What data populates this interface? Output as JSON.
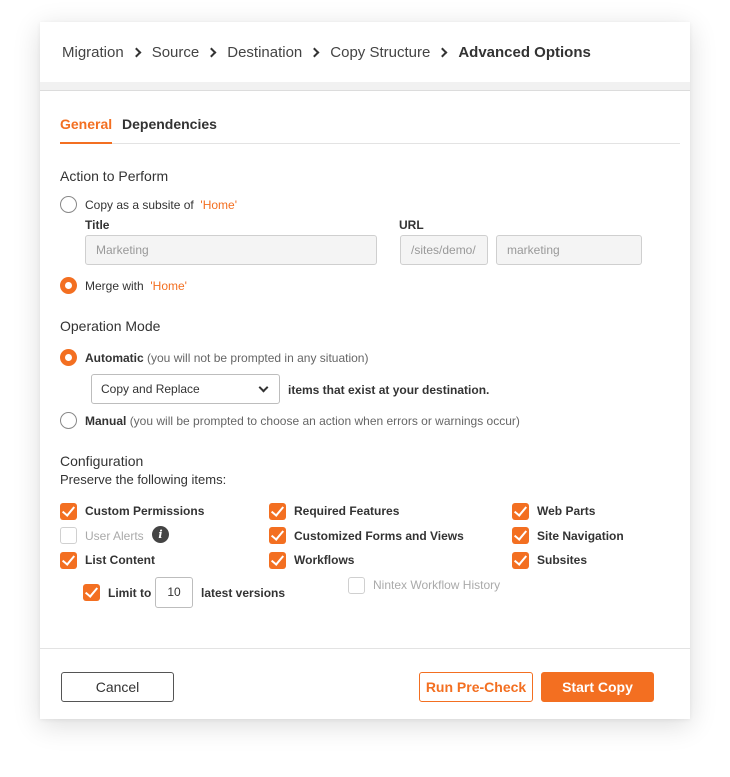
{
  "breadcrumb": {
    "items": [
      "Migration",
      "Source",
      "Destination",
      "Copy Structure",
      "Advanced Options"
    ]
  },
  "tabs": [
    {
      "label": "General",
      "active": true
    },
    {
      "label": "Dependencies",
      "active": false
    }
  ],
  "action": {
    "title": "Action to Perform",
    "subsite_prefix": "Copy as a subsite of",
    "subsite_target": "'Home'",
    "title_label": "Title",
    "url_label": "URL",
    "title_placeholder": "Marketing",
    "url_prefix": "/sites/demo/",
    "url_placeholder": "marketing",
    "merge_prefix": "Merge with",
    "merge_target": "'Home'",
    "selected": "merge"
  },
  "operation": {
    "title": "Operation Mode",
    "automatic_label": "Automatic",
    "automatic_note": "(you will not be prompted in any situation)",
    "select_value": "Copy and Replace",
    "select_suffix": "items that exist at your destination.",
    "manual_label": "Manual",
    "manual_note": "(you will be prompted to choose an action when errors or warnings occur)",
    "selected": "automatic"
  },
  "configuration": {
    "title": "Configuration",
    "subtitle": "Preserve the following items:",
    "items": {
      "custom_permissions": {
        "label": "Custom Permissions",
        "checked": true
      },
      "user_alerts": {
        "label": "User Alerts",
        "checked": false,
        "disabled": true
      },
      "list_content": {
        "label": "List Content",
        "checked": true
      },
      "required_features": {
        "label": "Required Features",
        "checked": true
      },
      "customized_forms": {
        "label": "Customized Forms and Views",
        "checked": true
      },
      "workflows": {
        "label": "Workflows",
        "checked": true
      },
      "nintex_history": {
        "label": "Nintex Workflow History",
        "checked": false,
        "disabled": true
      },
      "web_parts": {
        "label": "Web Parts",
        "checked": true
      },
      "site_navigation": {
        "label": "Site Navigation",
        "checked": true
      },
      "subsites": {
        "label": "Subsites",
        "checked": true
      }
    },
    "limit_label": "Limit to",
    "limit_value": "10",
    "limit_suffix": "latest versions"
  },
  "footer": {
    "cancel_label": "Cancel",
    "precheck_label": "Run Pre-Check",
    "start_label": "Start Copy"
  },
  "colors": {
    "accent": "#f36f21"
  }
}
